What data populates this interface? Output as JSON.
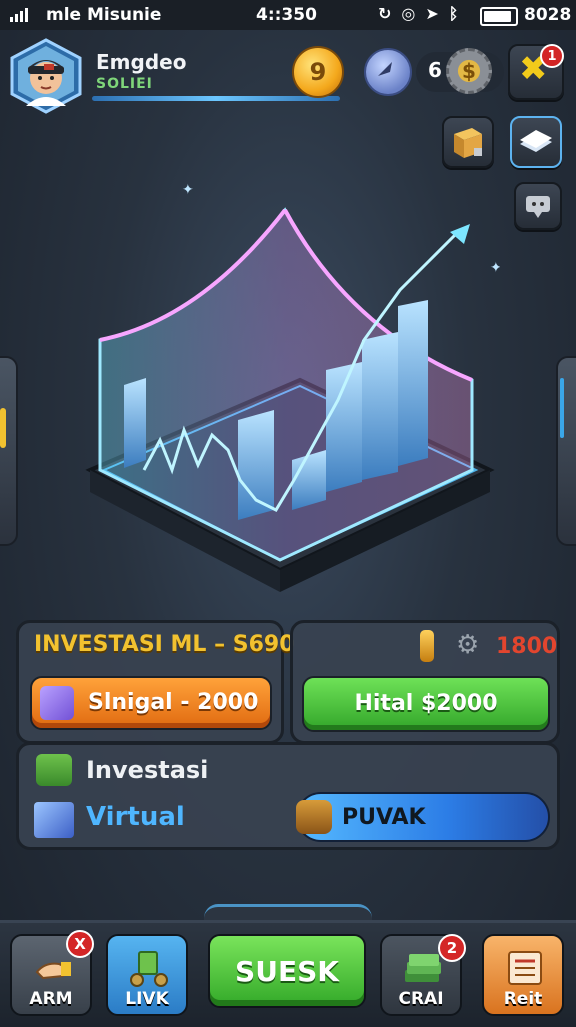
{
  "status_bar": {
    "carrier": "mle Misunie",
    "time": "4::350",
    "battery": "8028"
  },
  "player": {
    "name": "Emgdeo",
    "level_label": "SOLIEI",
    "coin_symbol": "9"
  },
  "resources": {
    "gear_count": "6",
    "gear_symbol": "$"
  },
  "notifications": {
    "close_badge": "1"
  },
  "invest_panel": {
    "title": "INVESTASI ML – S690",
    "signal_button": "Slnigal - 2000"
  },
  "cost_panel": {
    "value": "1800",
    "kital_button": "Hital $2000"
  },
  "virtual_panel": {
    "investasi_label": "Investasi",
    "virtual_label": "Virtual",
    "puvak_button": "PUVAK"
  },
  "bottom_nav": {
    "arm_label": "ARM",
    "arm_badge": "X",
    "livk_label": "LIVK",
    "suesk_label": "SUESK",
    "crai_label": "CRAI",
    "crai_badge": "2",
    "reit_label": "Reit"
  },
  "colors": {
    "accent_gold": "#f2c230",
    "accent_green": "#33a62a",
    "accent_orange": "#e06a10",
    "accent_blue": "#2c7de6",
    "alert_red": "#d32525",
    "cost_red": "#e2452e"
  },
  "icons": [
    "signal-icon",
    "wifi-icon",
    "location-icon",
    "bluetooth-icon",
    "battery-icon",
    "coin-icon",
    "chat-icon",
    "gear-icon",
    "close-icon",
    "crate-icon",
    "map-icon",
    "message-icon",
    "cube-icon",
    "gold-bar-icon",
    "cog-icon",
    "money-icon",
    "stack-icon",
    "gear-token-icon",
    "hand-icon",
    "cash-icon",
    "list-icon"
  ]
}
